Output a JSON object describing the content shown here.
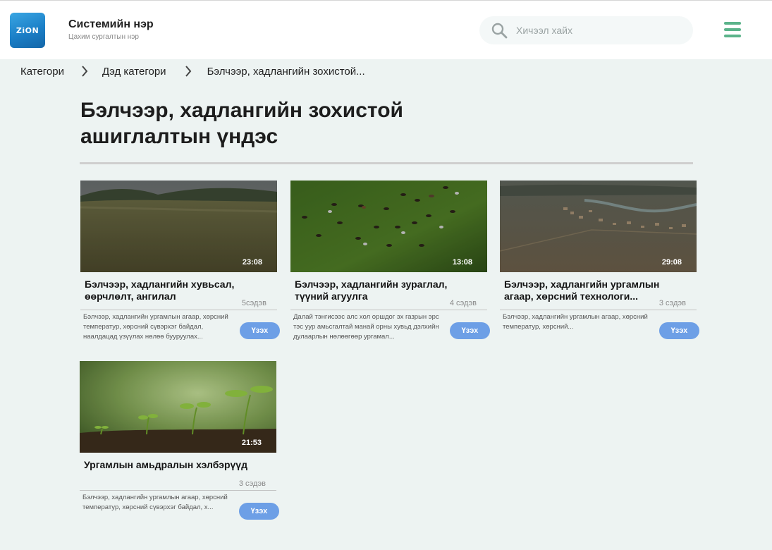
{
  "header": {
    "logo_text": "ZiON",
    "system_name": "Системийн нэр",
    "system_subtitle": "Цахим сургалтын нэр",
    "search_placeholder": "Хичээл хайх",
    "accent_color": "#5bb38a"
  },
  "breadcrumb": {
    "items": [
      "Категори",
      "Дэд категори",
      "Бэлчээр, хадлангийн зохистой..."
    ]
  },
  "page": {
    "title": "Бэлчээр, хадлангийн зохистой ашиглалтын үндэс"
  },
  "courses": [
    {
      "title": "Бэлчээр, хадлангийн хувьсал, өөрчлөлт, ангилал",
      "duration": "23:08",
      "lessons": "5сэдэв",
      "description": "Бэлчээр, хадлангийн ургамлын агаар, хөрсний температур, хөрсний сүвэрхэг байдал, наалдацад үзүүлах нөлөө бууруулах...",
      "button": "Үзэх",
      "image": "grassland-field"
    },
    {
      "title": "Бэлчээр, хадлангийн зураглал, түүний агуулга",
      "duration": "13:08",
      "lessons": "4 сэдэв",
      "description": "Далай тэнгисээс алс хол оршдог эх газрын эрс тэс уур амьсгалтай манай орны хувьд дэлхийн дулаарлын нөлөөгөөр ургамал...",
      "button": "Үзэх",
      "image": "cattle-aerial"
    },
    {
      "title": "Бэлчээр, хадлангийн ургамлын агаар, хөрсний технологи...",
      "duration": "29:08",
      "lessons": "3 сэдэв",
      "description": "Бэлчээр, хадлангийн ургамлын агаар, хөрсний температур, хөрсний...",
      "button": "Үзэх",
      "image": "river-town-aerial"
    },
    {
      "title": "Ургамлын амьдралын хэлбэрүүд",
      "duration": "21:53",
      "lessons": "3 сэдэв",
      "description": "Бэлчээр, хадлангийн ургамлын агаар, хөрсний температур, хөрсний сүвэрхэг байдал, х...",
      "button": "Үзэх",
      "image": "seedlings"
    }
  ]
}
